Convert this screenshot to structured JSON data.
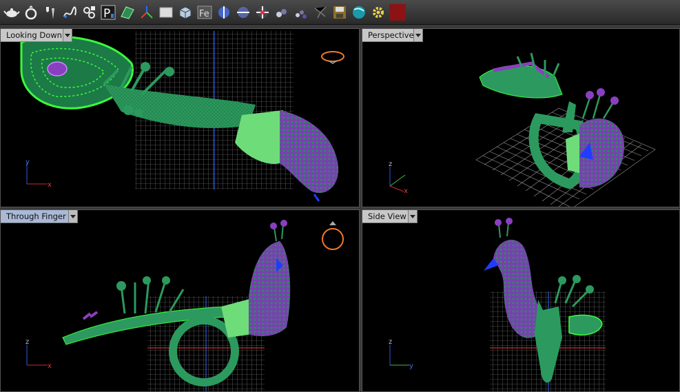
{
  "toolbar": {
    "icons": [
      "teapot-icon",
      "ring-icon",
      "pen-tool-icon",
      "spring-curve-icon",
      "gear-plugins-icon",
      "parameter-p-icon",
      "surface-icon",
      "axis-transform-icon",
      "plane-icon",
      "box-icon",
      "fe-text-icon",
      "mirror-half-icon",
      "section-split-icon",
      "center-snap-icon",
      "spheres-icon",
      "cluster-icon",
      "scatter-icon",
      "save-icon",
      "render-sphere-icon",
      "settings-gear-icon",
      "color-swatch-icon"
    ],
    "swatch_color": "#8b1313"
  },
  "viewports": {
    "top_left": {
      "label": "Looking Down",
      "axis_v": "y",
      "axis_h": "x"
    },
    "top_right": {
      "label": "Perspective",
      "axis_v": "z",
      "axis_h": "x"
    },
    "bottom_left": {
      "label": "Through Finger",
      "axis_v": "z",
      "axis_h": "x"
    },
    "bottom_right": {
      "label": "Side View",
      "axis_v": "z",
      "axis_h": "y"
    }
  },
  "colors": {
    "model_green": "#2c9a5e",
    "model_light_green": "#6fdc7a",
    "model_purple": "#8a3fc0",
    "grid": "#9a9a9a",
    "selection_green": "#39ff3a",
    "beak_blue": "#1f3cff"
  }
}
